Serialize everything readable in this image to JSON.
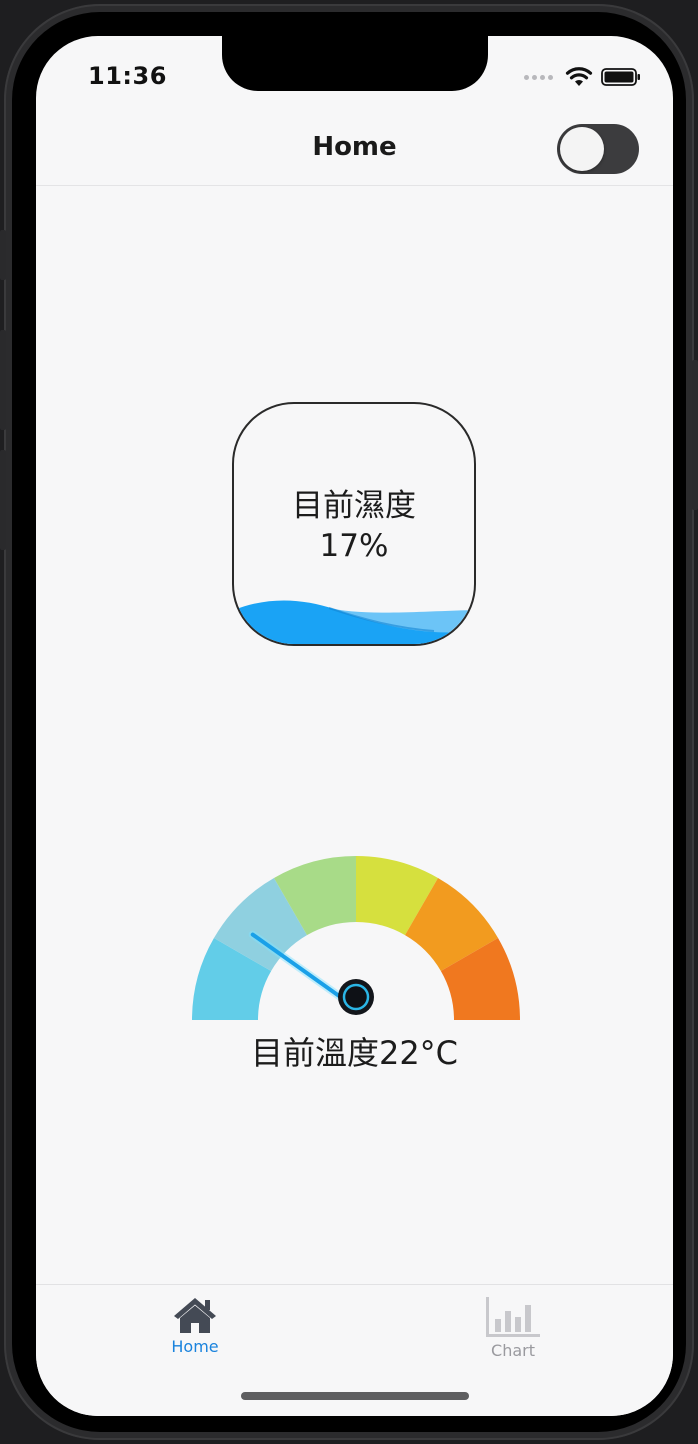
{
  "status_bar": {
    "time": "11:36",
    "icons": [
      "signal-dots-icon",
      "wifi-icon",
      "battery-icon"
    ]
  },
  "header": {
    "title": "Home",
    "toggle": {
      "on": false
    }
  },
  "humidity": {
    "label": "目前濕度",
    "value": "17%",
    "fill_fraction": 0.17,
    "wave_color": "#1aa3f5"
  },
  "temperature": {
    "label": "目前溫度22°C",
    "value": 22,
    "gauge_colors": [
      "#62cde8",
      "#8fd0e0",
      "#a8db88",
      "#d6e03e",
      "#f29b1f",
      "#f0781f"
    ]
  },
  "tabs": [
    {
      "label": "Home",
      "icon": "home-icon",
      "active": true,
      "color": "#1a83dd"
    },
    {
      "label": "Chart",
      "icon": "bar-chart-icon",
      "active": false,
      "color": "#9a9a9f"
    }
  ]
}
